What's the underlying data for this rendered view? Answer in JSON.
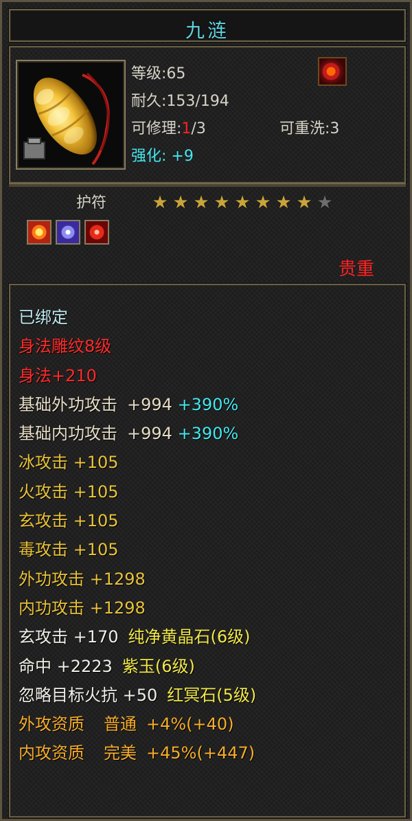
{
  "title": "九涟",
  "item": {
    "level_label": "等级:65",
    "durability_label": "耐久:153/194",
    "repair_prefix": "可修理:",
    "repair_current": "1",
    "repair_total": "/3",
    "rewash_label": "可重洗:3",
    "enhance_label": "强化:",
    "enhance_value": "+9"
  },
  "amulet": {
    "label": "护符",
    "stars_filled": 8,
    "stars_total": 9
  },
  "rarity": "贵重",
  "bound_label": "已绑定",
  "attrs": {
    "engrave": "身法雕纹8级",
    "agility": "身法+210",
    "base_ext_label": "基础外功攻击",
    "base_ext_value": "+994",
    "base_ext_pct": "+390%",
    "base_int_label": "基础内功攻击",
    "base_int_value": "+994",
    "base_int_pct": "+390%",
    "ice": "冰攻击 +105",
    "fire": "火攻击 +105",
    "myst": "玄攻击 +105",
    "poison": "毒攻击 +105",
    "ext_atk": "外功攻击 +1298",
    "int_atk": "内功攻击 +1298",
    "gem1_stat": "玄攻击 +170",
    "gem1_name": "纯净黄晶石(6级)",
    "gem2_stat": "命中 +2223",
    "gem2_name": "紫玉(6级)",
    "gem3_stat": "忽略目标火抗 +50",
    "gem3_name": "红冥石(5级)",
    "q1_label": "外攻资质",
    "q1_grade": "普通",
    "q1_value": "+4%(+40)",
    "q2_label": "内攻资质",
    "q2_grade": "完美",
    "q2_value": "+45%(+447)"
  }
}
